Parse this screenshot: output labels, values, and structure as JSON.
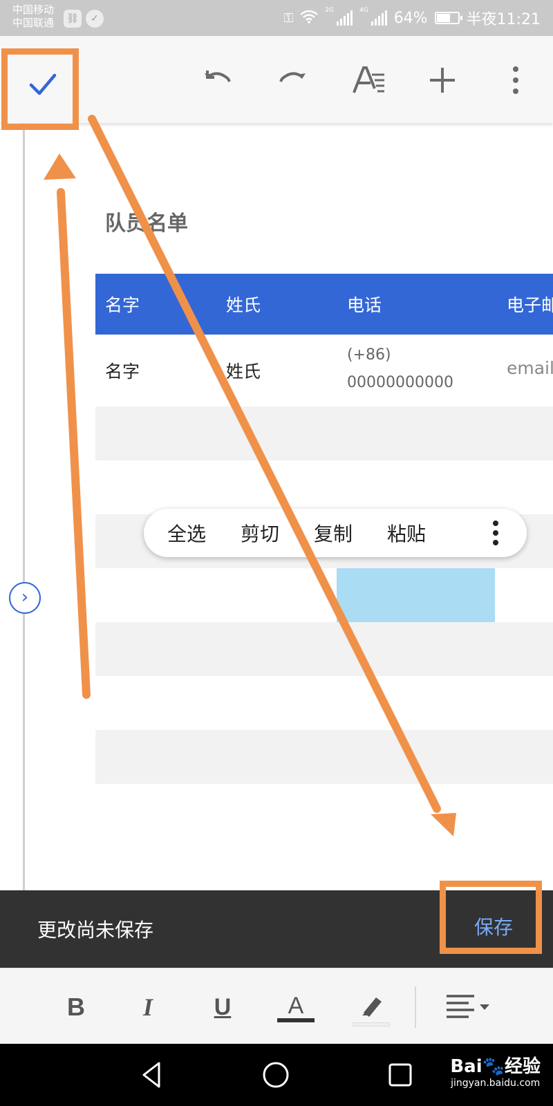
{
  "status_bar": {
    "carrier_1": "中国移动",
    "carrier_2": "中国联通",
    "net_2g": "2G",
    "net_4g": "4G",
    "battery": "64%",
    "time": "半夜11:21"
  },
  "toolbar": {
    "done_icon": "check-icon",
    "icons": [
      "undo-icon",
      "redo-icon",
      "text-format-icon",
      "insert-icon",
      "more-vert-icon"
    ]
  },
  "document": {
    "title": "队员名单",
    "table": {
      "headers": [
        "名字",
        "姓氏",
        "电话",
        "电子邮"
      ],
      "row": {
        "first_name": "名字",
        "last_name": "姓氏",
        "phone_line1": "(+86)",
        "phone_line2": "00000000000",
        "email": "email"
      }
    }
  },
  "context_menu": {
    "items": [
      "全选",
      "剪切",
      "复制",
      "粘贴"
    ],
    "more_icon": "more-vert-icon"
  },
  "snackbar": {
    "message": "更改尚未保存",
    "action": "保存"
  },
  "format_bar": {
    "bold": "B",
    "italic": "I",
    "underline": "U",
    "text_color": "A"
  },
  "watermark": {
    "line1": "Bai🐾经验",
    "line2": "jingyan.baidu.com"
  },
  "colors": {
    "accent": "#3367d6",
    "annotation": "#f0914a",
    "selection": "#aadcf3",
    "snackbar": "#323232",
    "save_text": "#7baaf7"
  }
}
